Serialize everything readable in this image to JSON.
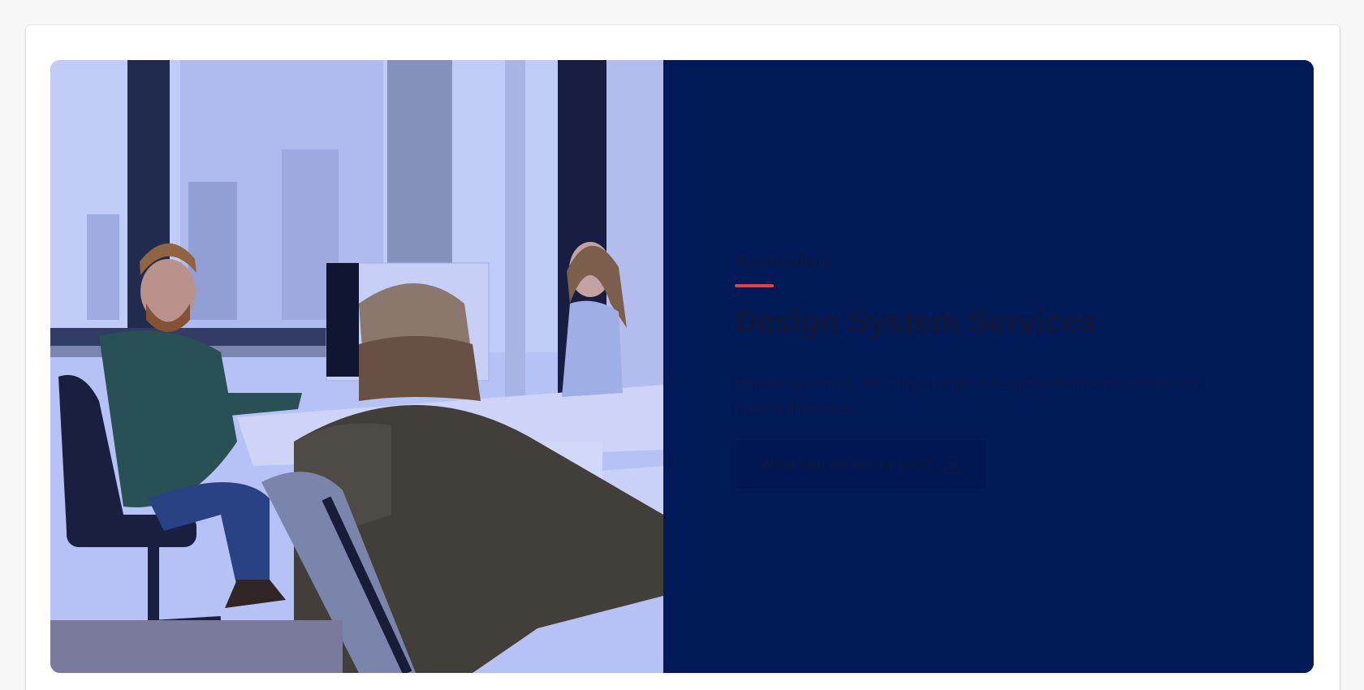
{
  "hero": {
    "subheadline": "Subheadline",
    "title": "Design System Services",
    "description": "Here at Systemics, we bring a range of design system services that can make a difference.",
    "cta": {
      "label": "What can we do for you?",
      "icon": "user-icon"
    },
    "image": {
      "subject": "office-team-photo"
    }
  },
  "colors": {
    "panel_background": "#001957",
    "accent": "#ef3e42",
    "photo_tint": "#3c5ae6",
    "page_background": "#f7f7f8"
  }
}
